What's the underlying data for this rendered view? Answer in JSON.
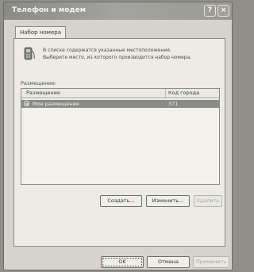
{
  "window": {
    "title": "Телефон и модем",
    "help_label": "?",
    "close_label": "×"
  },
  "tabs": [
    {
      "label": "Набор номера",
      "active": true
    }
  ],
  "info": {
    "line1": "В списке содержатся указанные местоположения.",
    "line2": "Выберите место, из которого производится набор номера."
  },
  "locations": {
    "group_label": "Размещение:",
    "columns": {
      "location": "Размещение",
      "area_code": "Код города"
    },
    "rows": [
      {
        "name": "Мое размещение",
        "area_code": "371",
        "selected": true
      }
    ]
  },
  "list_buttons": {
    "create": "Создать...",
    "edit": "Изменить...",
    "delete": "Удалить"
  },
  "dialog_buttons": {
    "ok": "OK",
    "cancel": "Отмена",
    "apply": "Применить"
  }
}
